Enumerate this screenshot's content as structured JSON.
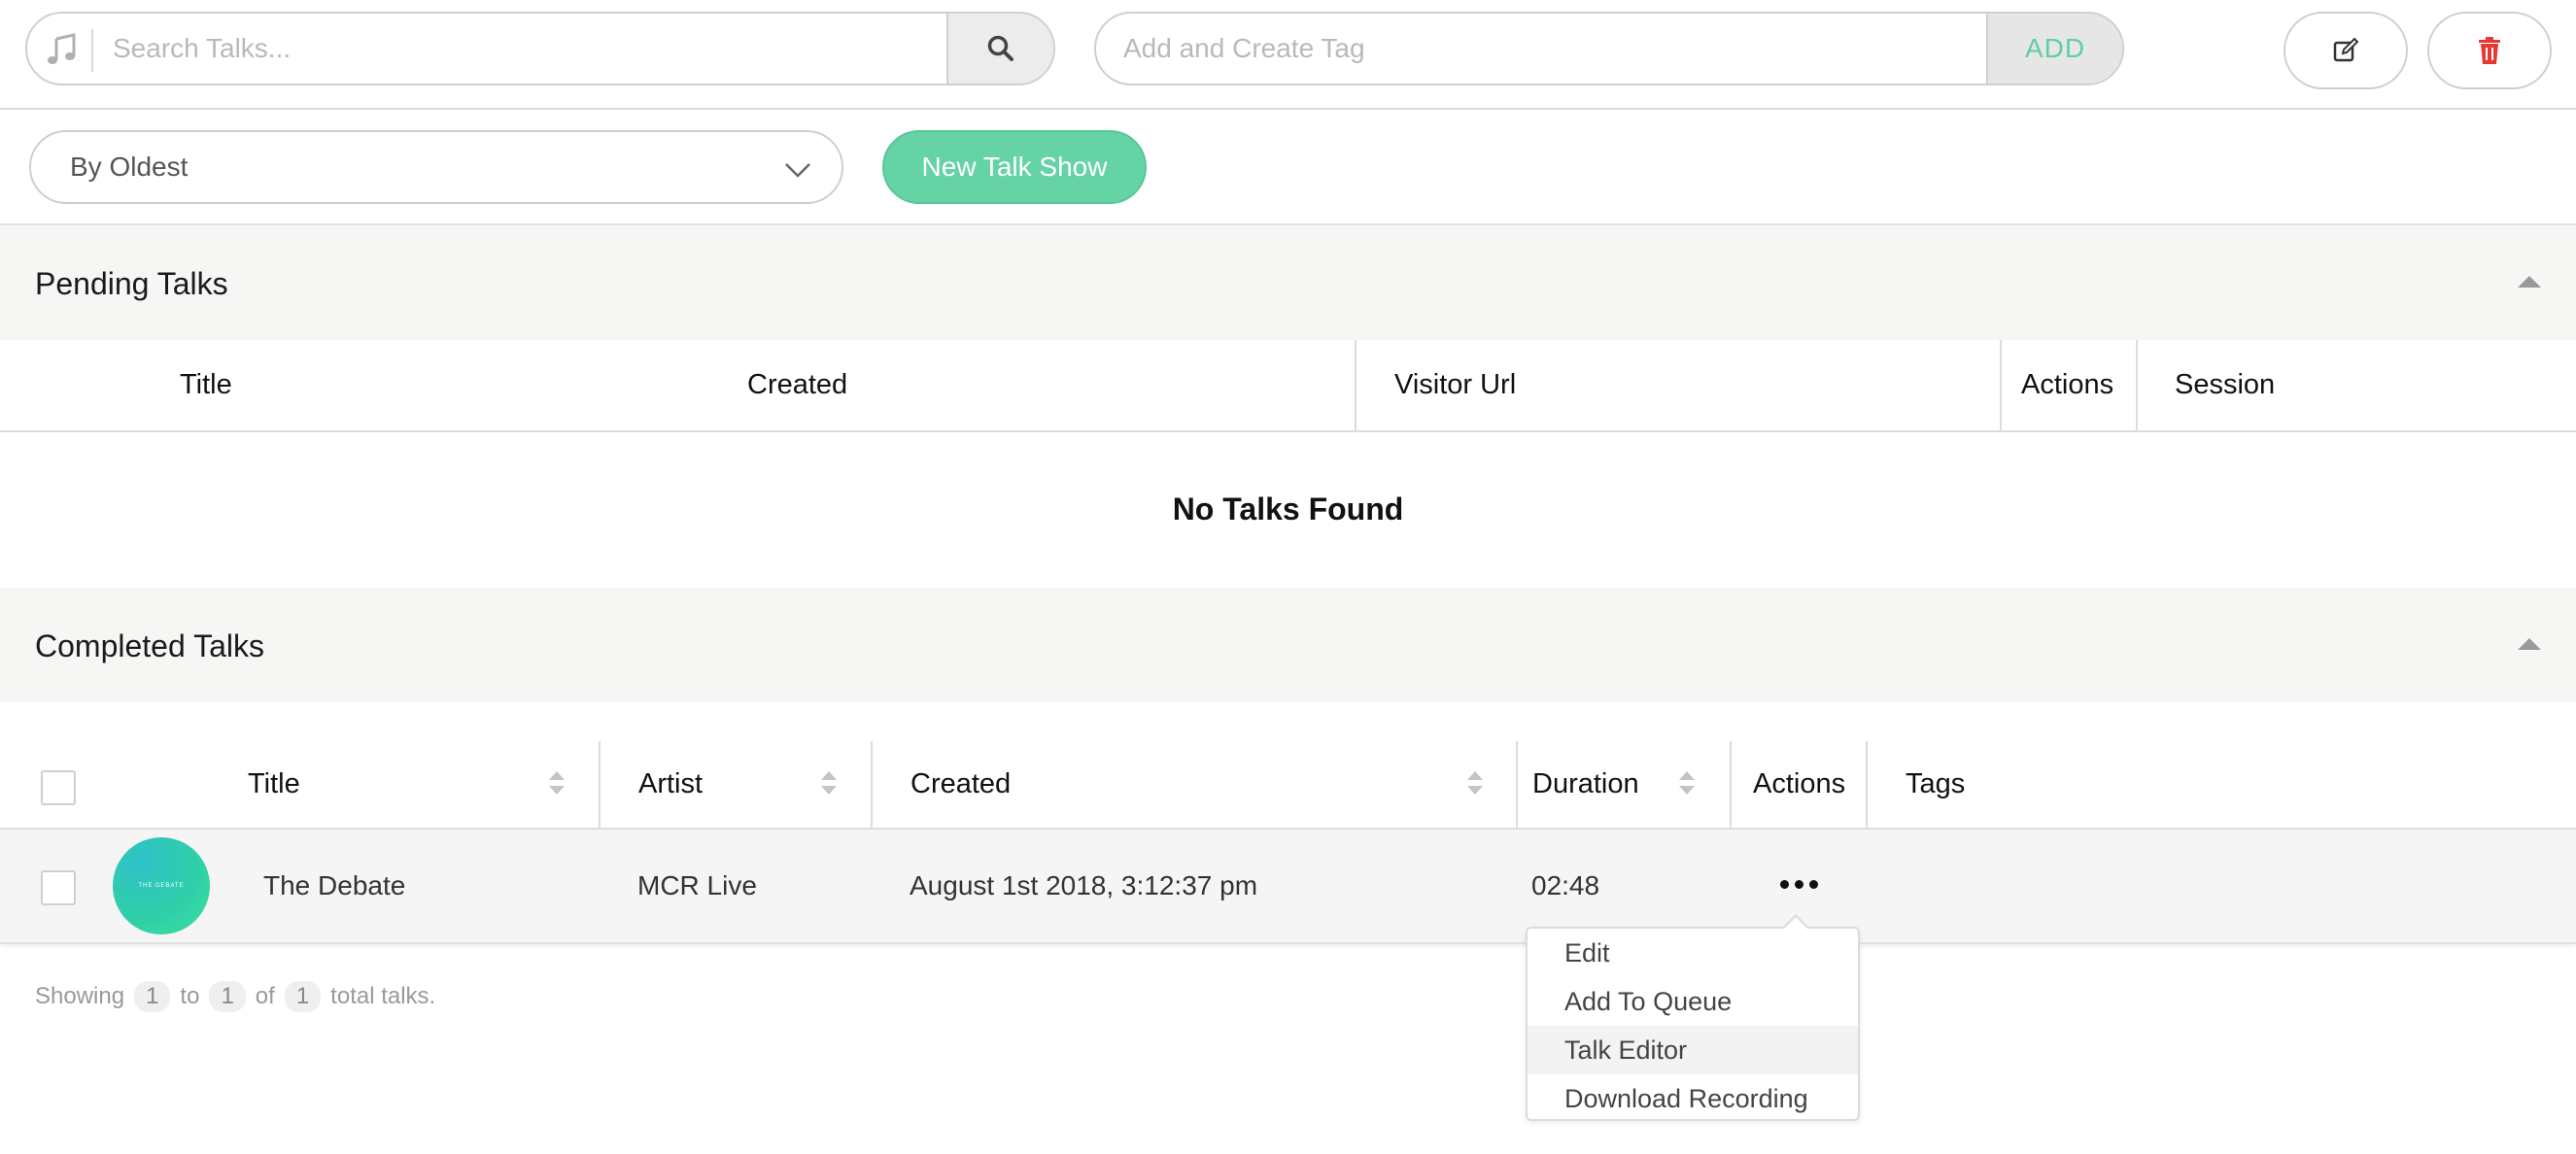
{
  "header": {
    "search_placeholder": "Search Talks...",
    "tag_placeholder": "Add and Create Tag",
    "add_label": "ADD",
    "icons": {
      "music": "music-note-icon",
      "search": "magnifier-icon",
      "edit": "edit-icon",
      "delete": "trash-icon"
    },
    "delete_color": "#e53935"
  },
  "toolbar": {
    "sort_selected": "By Oldest",
    "new_talk_label": "New Talk Show",
    "accent": "#66d3a7"
  },
  "pending": {
    "title": "Pending Talks",
    "columns": [
      "Title",
      "Created",
      "Visitor Url",
      "Actions",
      "Session"
    ],
    "empty_text": "No Talks Found"
  },
  "completed": {
    "title": "Completed Talks",
    "columns": [
      "Title",
      "Artist",
      "Created",
      "Duration",
      "Actions",
      "Tags"
    ],
    "rows": [
      {
        "thumb_text": "THE DEBATE",
        "title": "The Debate",
        "artist": "MCR Live",
        "created": "August 1st 2018, 3:12:37 pm",
        "duration": "02:48"
      }
    ],
    "footer": {
      "showing": "Showing",
      "from": "1",
      "to_word": "to",
      "to": "1",
      "of_word": "of",
      "total": "1",
      "suffix": "total talks."
    }
  },
  "actions_menu": {
    "items": [
      "Edit",
      "Add To Queue",
      "Talk Editor",
      "Download Recording"
    ],
    "highlighted": "Talk Editor"
  }
}
